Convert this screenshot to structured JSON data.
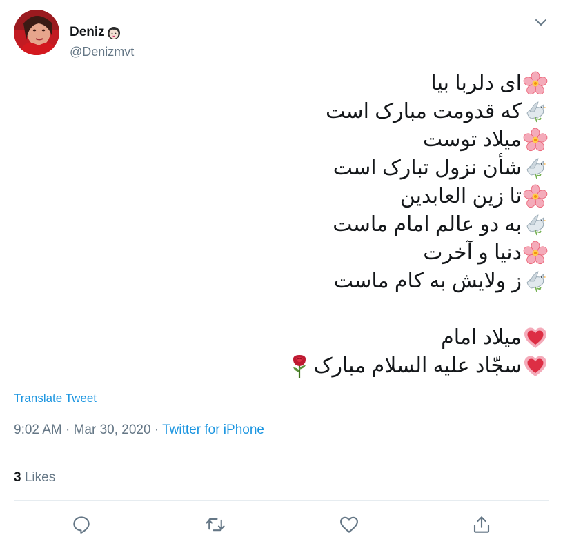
{
  "colors": {
    "link": "#1b95e0",
    "muted": "#657786",
    "text": "#14171a",
    "divider": "#e6ecf0"
  },
  "user": {
    "display_name": "Deniz",
    "name_emoji": "woman-face-emoji",
    "handle": "@Denizmvt",
    "avatar": "profile-photo"
  },
  "menu": {
    "icon": "chevron-down-icon"
  },
  "tweet": {
    "lines": [
      {
        "emoji": "cherry-blossom",
        "text": "ای دلربا بیا"
      },
      {
        "emoji": "dove",
        "text": "که قدومت مبارک است"
      },
      {
        "emoji": "cherry-blossom",
        "text": "میلاد توست"
      },
      {
        "emoji": "dove",
        "text": "شأن نزول تبارک است"
      },
      {
        "emoji": "cherry-blossom",
        "text": "تا زین العابدین"
      },
      {
        "emoji": "dove",
        "text": "به دو عالم امام ماست"
      },
      {
        "emoji": "cherry-blossom",
        "text": "دنیا و آخرت"
      },
      {
        "emoji": "dove",
        "text": "ز ولایش به کام ماست"
      }
    ],
    "closing": [
      {
        "emoji": "heart",
        "text": "میلاد امام"
      },
      {
        "emoji": "heart",
        "text": "سجّاد علیه السلام مبارک",
        "end_emoji": "rose"
      }
    ]
  },
  "translate_label": "Translate Tweet",
  "meta": {
    "time": "9:02 AM",
    "sep1": " · ",
    "date": "Mar 30, 2020",
    "sep2": " · ",
    "source": "Twitter for iPhone"
  },
  "stats": {
    "likes_count": "3",
    "likes_label": "Likes"
  },
  "actions": [
    {
      "name": "reply",
      "icon": "reply-icon"
    },
    {
      "name": "retweet",
      "icon": "retweet-icon"
    },
    {
      "name": "like",
      "icon": "heart-icon"
    },
    {
      "name": "share",
      "icon": "share-icon"
    }
  ]
}
